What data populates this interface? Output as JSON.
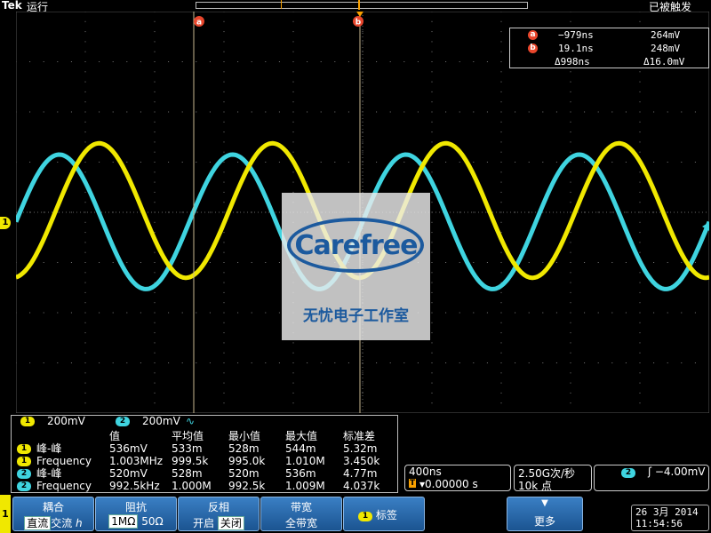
{
  "status": {
    "logo": "Tek",
    "run_state": "运行",
    "trigger_state": "已被触发"
  },
  "cursors": {
    "a_label": "a",
    "b_label": "b",
    "a_time": "−979ns",
    "a_volt": "264mV",
    "b_time": "19.1ns",
    "b_volt": "248mV",
    "delta_time": "Δ998ns",
    "delta_volt": "Δ16.0mV"
  },
  "channels": {
    "ch1": {
      "label": "1",
      "scale": "200mV",
      "color": "#f0e800"
    },
    "ch2": {
      "label": "2",
      "scale": "200mV",
      "bw_icon": "∿",
      "color": "#3fd4e0"
    }
  },
  "watermark": {
    "brand": "Carefree",
    "subtitle": "无忧电子工作室"
  },
  "measurements": {
    "headers": [
      "值",
      "平均值",
      "最小值",
      "最大值",
      "标准差"
    ],
    "rows": [
      {
        "ch": "1",
        "name": "峰-峰",
        "values": [
          "536mV",
          "533m",
          "528m",
          "544m",
          "5.32m"
        ]
      },
      {
        "ch": "1",
        "name": "Frequency",
        "values": [
          "1.003MHz",
          "999.5k",
          "995.0k",
          "1.010M",
          "3.450k"
        ]
      },
      {
        "ch": "2",
        "name": "峰-峰",
        "values": [
          "520mV",
          "528m",
          "520m",
          "536m",
          "4.77m"
        ]
      },
      {
        "ch": "2",
        "name": "Frequency",
        "values": [
          "992.5kHz",
          "1.000M",
          "992.5k",
          "1.009M",
          "4.037k"
        ]
      }
    ]
  },
  "horizontal": {
    "timebase": "400ns",
    "position": "▾0.00000 s",
    "sample_rate": "2.50G次/秒",
    "record_length": "10k 点"
  },
  "trigger": {
    "source": "2",
    "slope_level": "ʃ −4.00mV"
  },
  "menu": {
    "ch_tab": "1",
    "coupling": {
      "title": "耦合",
      "options": [
        "直流",
        "交流",
        "ℎ"
      ],
      "selected": 0
    },
    "impedance": {
      "title": "阻抗",
      "options": [
        "1MΩ",
        "50Ω"
      ],
      "selected": 0
    },
    "invert": {
      "title": "反相",
      "options": [
        "开启",
        "关闭"
      ],
      "selected": 1
    },
    "bandwidth": {
      "title": "带宽",
      "value": "全带宽"
    },
    "label": {
      "ch": "1",
      "title": "标签"
    },
    "more": {
      "title": "更多",
      "icon": "▼"
    }
  },
  "datetime": {
    "date": "26 3月 2014",
    "time": "11:54:56"
  }
}
